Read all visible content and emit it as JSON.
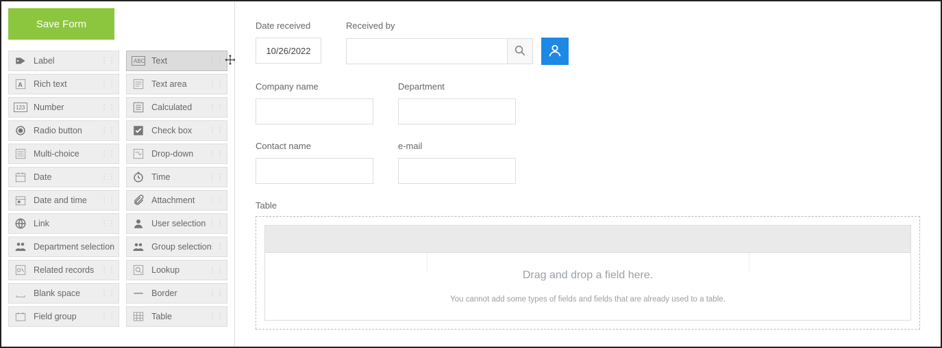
{
  "sidebar": {
    "save_label": "Save Form",
    "items": [
      {
        "label": "Label",
        "icon": "label-icon"
      },
      {
        "label": "Text",
        "icon": "text-icon",
        "dragging": true
      },
      {
        "label": "Rich text",
        "icon": "rich-text-icon"
      },
      {
        "label": "Text area",
        "icon": "text-area-icon"
      },
      {
        "label": "Number",
        "icon": "number-icon"
      },
      {
        "label": "Calculated",
        "icon": "calculated-icon"
      },
      {
        "label": "Radio button",
        "icon": "radio-button-icon"
      },
      {
        "label": "Check box",
        "icon": "checkbox-icon"
      },
      {
        "label": "Multi-choice",
        "icon": "multi-choice-icon"
      },
      {
        "label": "Drop-down",
        "icon": "dropdown-icon"
      },
      {
        "label": "Date",
        "icon": "date-icon"
      },
      {
        "label": "Time",
        "icon": "time-icon"
      },
      {
        "label": "Date and time",
        "icon": "datetime-icon"
      },
      {
        "label": "Attachment",
        "icon": "attachment-icon"
      },
      {
        "label": "Link",
        "icon": "link-icon"
      },
      {
        "label": "User selection",
        "icon": "user-selection-icon"
      },
      {
        "label": "Department selection",
        "icon": "department-selection-icon"
      },
      {
        "label": "Group selection",
        "icon": "group-selection-icon"
      },
      {
        "label": "Related records",
        "icon": "related-records-icon"
      },
      {
        "label": "Lookup",
        "icon": "lookup-icon"
      },
      {
        "label": "Blank space",
        "icon": "blank-space-icon"
      },
      {
        "label": "Border",
        "icon": "border-icon"
      },
      {
        "label": "Field group",
        "icon": "field-group-icon"
      },
      {
        "label": "Table",
        "icon": "table-icon"
      }
    ]
  },
  "form": {
    "date_received": {
      "label": "Date received",
      "value": "10/26/2022"
    },
    "received_by": {
      "label": "Received by",
      "value": ""
    },
    "company_name": {
      "label": "Company name",
      "value": ""
    },
    "department": {
      "label": "Department",
      "value": ""
    },
    "contact_name": {
      "label": "Contact name",
      "value": ""
    },
    "email": {
      "label": "e-mail",
      "value": ""
    },
    "table": {
      "label": "Table",
      "drop_hint": "Drag and drop a field here.",
      "drop_subhint": "You cannot add some types of fields and fields that are already used to a table."
    }
  }
}
